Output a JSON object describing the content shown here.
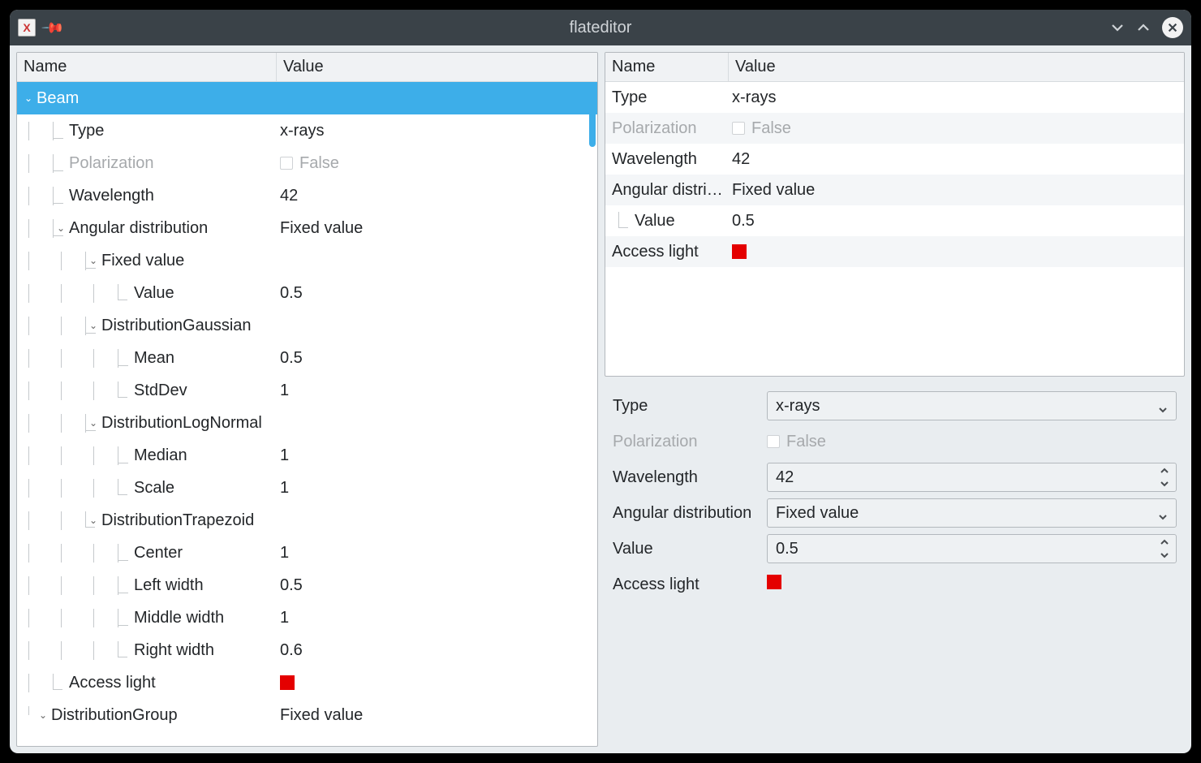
{
  "window": {
    "title": "flateditor"
  },
  "columns": {
    "name": "Name",
    "value": "Value"
  },
  "leftTree": {
    "beam": {
      "label": "Beam",
      "type": {
        "label": "Type",
        "value": "x-rays"
      },
      "polarization": {
        "label": "Polarization",
        "value": "False"
      },
      "wavelength": {
        "label": "Wavelength",
        "value": "42"
      },
      "angular": {
        "label": "Angular distribution",
        "value": "Fixed value",
        "fixed": {
          "label": "Fixed value",
          "value_label": "Value",
          "value": "0.5"
        },
        "gaussian": {
          "label": "DistributionGaussian",
          "mean_label": "Mean",
          "mean": "0.5",
          "stddev_label": "StdDev",
          "stddev": "1"
        },
        "lognormal": {
          "label": "DistributionLogNormal",
          "median_label": "Median",
          "median": "1",
          "scale_label": "Scale",
          "scale": "1"
        },
        "trapezoid": {
          "label": "DistributionTrapezoid",
          "center_label": "Center",
          "center": "1",
          "left_label": "Left width",
          "left": "0.5",
          "middle_label": "Middle width",
          "middle": "1",
          "right_label": "Right width",
          "right": "0.6"
        }
      },
      "access": {
        "label": "Access light",
        "color": "#e40000"
      }
    },
    "distGroup": {
      "label": "DistributionGroup",
      "value": "Fixed value"
    }
  },
  "rightTree": {
    "type": {
      "label": "Type",
      "value": "x-rays"
    },
    "polarization": {
      "label": "Polarization",
      "value": "False"
    },
    "wavelength": {
      "label": "Wavelength",
      "value": "42"
    },
    "angular": {
      "label": "Angular distri…",
      "value": "Fixed value",
      "child_label": "Value",
      "child_value": "0.5"
    },
    "access": {
      "label": "Access light",
      "color": "#e40000"
    }
  },
  "form": {
    "type": {
      "label": "Type",
      "value": "x-rays"
    },
    "polarization": {
      "label": "Polarization",
      "value": "False"
    },
    "wavelength": {
      "label": "Wavelength",
      "value": "42"
    },
    "angular": {
      "label": "Angular distribution",
      "value": "Fixed value"
    },
    "value": {
      "label": "Value",
      "value": "0.5"
    },
    "access": {
      "label": "Access light",
      "color": "#e40000"
    }
  }
}
